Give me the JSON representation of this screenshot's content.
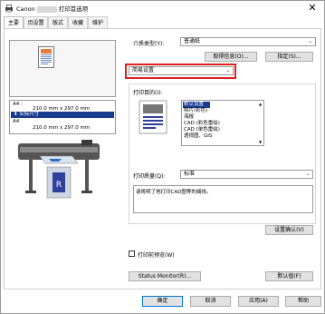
{
  "window": {
    "title_prefix": "Canon",
    "title_suffix": "打印首选项",
    "close": "✕"
  },
  "tabs": [
    "主要",
    "页设置",
    "版式",
    "收藏",
    "维护"
  ],
  "preview": {
    "paper_size_1": "A4 :",
    "dims_1": "210.0 mm x 297.0 mm",
    "actual_size": "实际尺寸",
    "paper_size_2": "A4",
    "dims_2": "210.0 mm x 297.0 mm"
  },
  "main": {
    "media_type_label": "介质类型(Y):",
    "media_type_value": "普通纸",
    "get_info_button": "取得信息(O)...",
    "specify_button": "指定(S)...",
    "setting_mode_value": "简易设置",
    "print_purpose_label": "打印目的(I):",
    "purposes": [
      "默认设置",
      "照片(彩色)",
      "海报",
      "CAD (彩色重绘)",
      "CAD (单色重绘)",
      "透视图、GIS"
    ],
    "print_quality_label": "打印质量(Q):",
    "print_quality_value": "标准",
    "description": "请将明了地打印CAD图等的细线。",
    "settings_confirm_button": "设置确认(V)",
    "preview_before_print_label": "打印前预览(W)",
    "status_monitor_button": "Status Monitor(R)...",
    "defaults_button": "默认值(F)"
  },
  "footer": {
    "ok": "确定",
    "cancel": "取消",
    "apply": "应用(A)",
    "help": "帮助"
  },
  "colors": {
    "highlight": "#1a3c8f",
    "red_outline": "#e02020"
  }
}
